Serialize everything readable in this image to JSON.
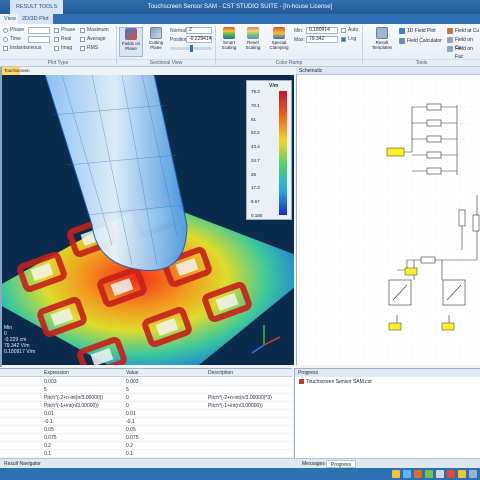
{
  "titlebar": {
    "context_tab": "RESULT TOOLS",
    "title": "Touchscreen Sensor SAM - CST STUDIO SUITE - [In-house License]"
  },
  "tabs": {
    "context_sub": "2D/3D Plot",
    "active": "View"
  },
  "ribbon": {
    "plot_type": {
      "phase_label": "Phase",
      "time_label": "Time",
      "inst_label": "Instantaneous",
      "phase2": "Phase",
      "real2": "Real",
      "imag2": "Imag",
      "max_label": "Maximum",
      "avg_label": "Average",
      "rms_label": "RMS",
      "group": "Plot Type"
    },
    "sectional": {
      "fields_on_plane": "Fields on Plane",
      "cutting_plane": "Cutting Plane",
      "normal_label": "Normal:",
      "normal_value": "Z",
      "position_label": "Position:",
      "position_value": "-0.229414",
      "group": "Sectional View"
    },
    "color_ramp": {
      "smart_scaling": "Smart Scaling",
      "reset_scaling": "Reset Scaling",
      "special_clamping": "Special Clamping",
      "min_label": "Min:",
      "min_value": "0.180914",
      "max_label": "Max:",
      "max_value": "79.342",
      "auto_label": "Auto",
      "log_label": "Log",
      "group": "Color Ramp"
    },
    "tools": {
      "result_templates": "Result Templates",
      "field_plot_1d": "1D Field Plot",
      "field_calculator": "Field Calculator",
      "field_at_cursor": "Field at Cu",
      "field_on_curve": "Field on Cu",
      "field_on_face": "Field on Fac",
      "group": "Tools"
    }
  },
  "doc_tab": "Touchscreen Sensor SAM",
  "schematic_tab": "Schematic",
  "colorbar": {
    "unit": "V/m",
    "ticks": [
      "79.3",
      "70.1",
      "61",
      "52.2",
      "43.4",
      "34.7",
      "26",
      "17.3",
      "8.67",
      "0.180"
    ]
  },
  "info": {
    "line1": "Min",
    "line2": "0",
    "line3": "-0.229 cm",
    "line4": "79.342 V/m",
    "line5": "0.180917 V/m"
  },
  "params": {
    "headers": [
      "",
      "Expression",
      "Value",
      "Description"
    ],
    "rows": [
      [
        "",
        "0.003",
        "0.003",
        ""
      ],
      [
        "",
        "5",
        "5",
        ""
      ],
      [
        "",
        "Pitch*(-2+n-int(n/3.00000))",
        "0",
        "Pitch*(-2+n-int(n/3.00000)*3)"
      ],
      [
        "",
        "Pitch*(-1+int(n/3.00000))",
        "0",
        "Pitch*(-1+int(n/3.00000))"
      ],
      [
        "",
        "0.01",
        "0.01",
        ""
      ],
      [
        "",
        "-0.1",
        "-0.1",
        ""
      ],
      [
        "",
        "0.05",
        "0.05",
        ""
      ],
      [
        "",
        "0.075",
        "0.075",
        ""
      ],
      [
        "",
        "0.2",
        "0.2",
        ""
      ],
      [
        "",
        "0.1",
        "0.1",
        ""
      ]
    ]
  },
  "progress": {
    "header": "Progress",
    "item": "Touchscreen Sensor SAM.cst"
  },
  "bottom_tabs": {
    "left": "Result Navigator",
    "messages": "Messages",
    "progress": "Progress"
  },
  "colors": {
    "accent": "#2f6fb3",
    "view_bg": "#0a2b4c",
    "doc_tab": "#ffd863"
  }
}
